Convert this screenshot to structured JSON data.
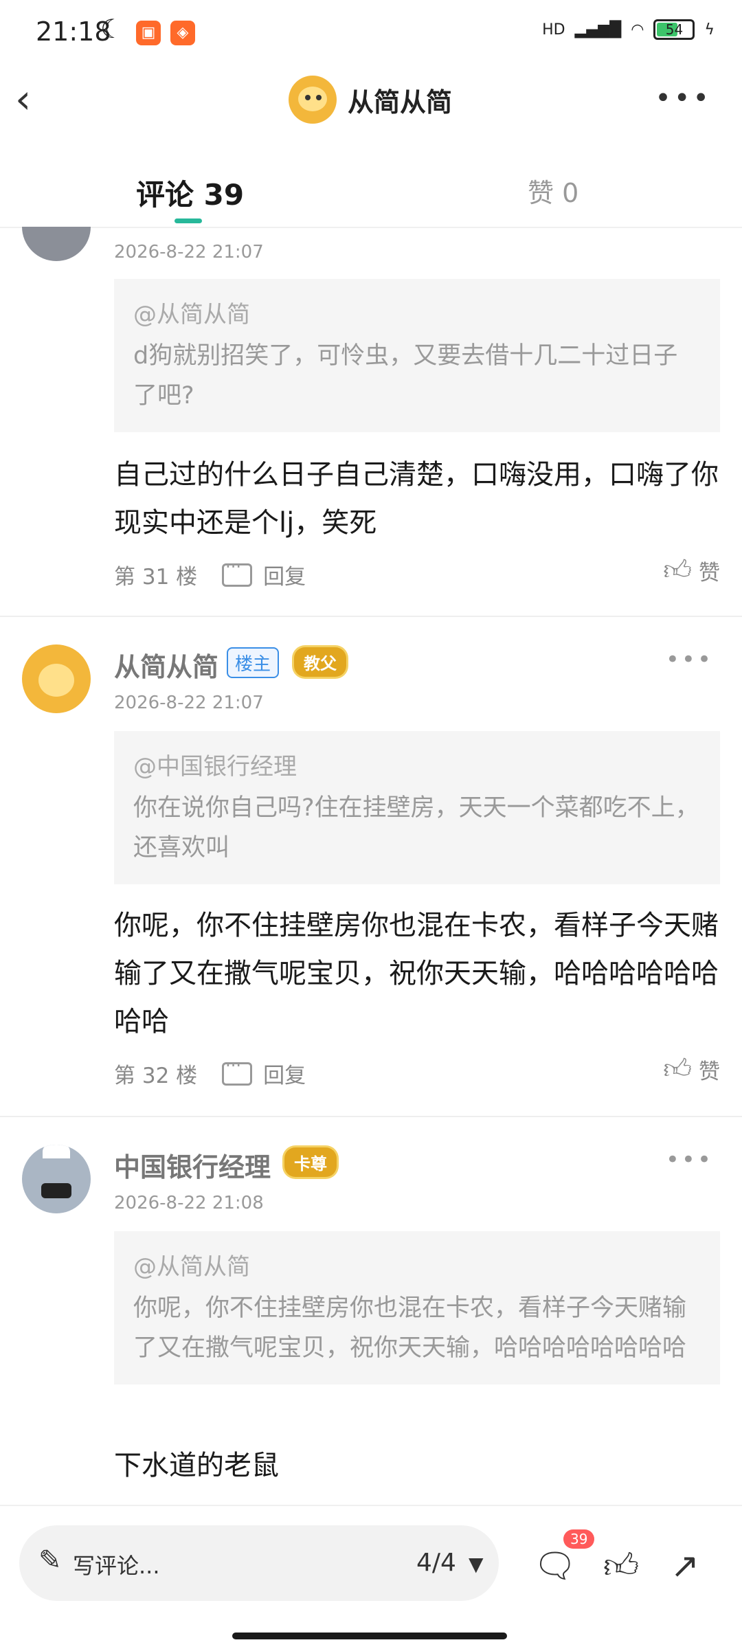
{
  "status_bar": {
    "time": "21:18",
    "network": "HD",
    "battery": "54"
  },
  "header": {
    "back_icon": "chevron-left-icon",
    "title": "从简从简",
    "more_icon": "more-dots-icon"
  },
  "tabs": [
    {
      "label": "评论 39",
      "active": true
    },
    {
      "label": "赞 0",
      "active": false
    }
  ],
  "posts": [
    {
      "username": "",
      "date": "2026-8-22 21:07",
      "quote_name": "@从简从简",
      "quote_text": "d狗就别招笑了，可怜虫，又要去借十几二十过日子了吧?",
      "text": "自己过的什么日子自己清楚，口嗨没用，口嗨了你现实中还是个lj，笑死",
      "floor": "第 31 楼",
      "reply_label": "回复",
      "like_label": "赞"
    },
    {
      "username": "从简从简",
      "badge_owner": "楼主",
      "badge_title": "教父",
      "date": "2026-8-22 21:07",
      "quote_name": "@中国银行经理",
      "quote_text": "你在说你自己吗?住在挂壁房，天天一个菜都吃不上，还喜欢叫",
      "text": "你呢，你不住挂壁房你也混在卡农，看样子今天赌输了又在撒气呢宝贝，祝你天天输，哈哈哈哈哈哈哈哈",
      "floor": "第 32 楼",
      "reply_label": "回复",
      "like_label": "赞"
    },
    {
      "username": "中国银行经理",
      "badge_title": "卡尊",
      "date": "2026-8-22 21:08",
      "quote_name": "@从简从简",
      "quote_text": "你呢，你不住挂壁房你也混在卡农，看样子今天赌输了又在撒气呢宝贝，祝你天天输，哈哈哈哈哈哈哈哈",
      "text": "下水道的老鼠"
    }
  ],
  "bottom_bar": {
    "input_placeholder": "写评论...",
    "page_indicator": "4/4",
    "comment_count": "39"
  }
}
